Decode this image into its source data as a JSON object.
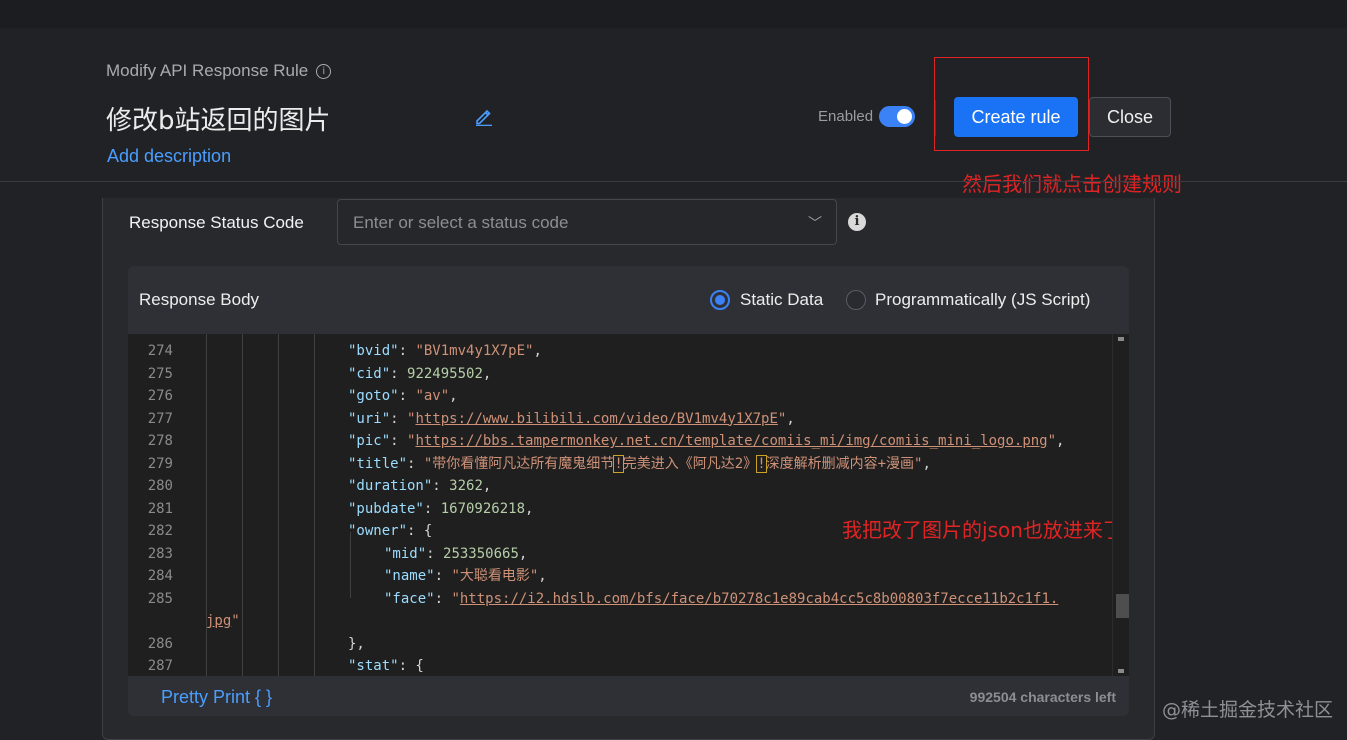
{
  "header": {
    "rule_type": "Modify API Response Rule",
    "info_glyph": "i",
    "rule_name": "修改b站返回的图片",
    "add_description": "Add description",
    "enabled_label": "Enabled",
    "enabled": true,
    "create_button": "Create rule",
    "close_button": "Close"
  },
  "annotations": {
    "create_note": "然后我们就点击创建规则",
    "json_note": "我把改了图片的json也放进来了"
  },
  "status": {
    "label": "Response Status Code",
    "placeholder": "Enter or select a status code",
    "chevron": "﹀",
    "info_glyph": "i"
  },
  "response_body": {
    "title": "Response Body",
    "options": [
      "Static Data",
      "Programmatically (JS Script)"
    ],
    "selected": "Static Data",
    "pretty_print": "Pretty Print { }",
    "chars_left": "992504 characters left"
  },
  "editor": {
    "lines": [
      {
        "n": "274",
        "indent": 4,
        "parts": [
          [
            "key",
            "\"bvid\""
          ],
          [
            "pun",
            ": "
          ],
          [
            "str",
            "\"BV1mv4y1X7pE\""
          ],
          [
            "pun",
            ","
          ]
        ]
      },
      {
        "n": "275",
        "indent": 4,
        "parts": [
          [
            "key",
            "\"cid\""
          ],
          [
            "pun",
            ": "
          ],
          [
            "num",
            "922495502"
          ],
          [
            "pun",
            ","
          ]
        ]
      },
      {
        "n": "276",
        "indent": 4,
        "parts": [
          [
            "key",
            "\"goto\""
          ],
          [
            "pun",
            ": "
          ],
          [
            "str",
            "\"av\""
          ],
          [
            "pun",
            ","
          ]
        ]
      },
      {
        "n": "277",
        "indent": 4,
        "parts": [
          [
            "key",
            "\"uri\""
          ],
          [
            "pun",
            ": "
          ],
          [
            "str",
            "\""
          ],
          [
            "url",
            "https://www.bilibili.com/video/BV1mv4y1X7pE"
          ],
          [
            "str",
            "\""
          ],
          [
            "pun",
            ","
          ]
        ]
      },
      {
        "n": "278",
        "indent": 4,
        "parts": [
          [
            "key",
            "\"pic\""
          ],
          [
            "pun",
            ": "
          ],
          [
            "str",
            "\""
          ],
          [
            "url",
            "https://bbs.tampermonkey.net.cn/template/comiis_mi/img/comiis_mini_logo.png"
          ],
          [
            "str",
            "\""
          ],
          [
            "pun",
            ","
          ]
        ]
      },
      {
        "n": "279",
        "indent": 4,
        "parts": [
          [
            "key",
            "\"title\""
          ],
          [
            "pun",
            ": "
          ],
          [
            "str",
            "\"带你看懂阿凡达所有魔鬼细节"
          ],
          [
            "hl",
            "!"
          ],
          [
            "str",
            "完美进入《阿凡达2》"
          ],
          [
            "hl",
            "!"
          ],
          [
            "str",
            "深度解析删减内容+漫画\""
          ],
          [
            "pun",
            ","
          ]
        ]
      },
      {
        "n": "280",
        "indent": 4,
        "parts": [
          [
            "key",
            "\"duration\""
          ],
          [
            "pun",
            ": "
          ],
          [
            "num",
            "3262"
          ],
          [
            "pun",
            ","
          ]
        ]
      },
      {
        "n": "281",
        "indent": 4,
        "parts": [
          [
            "key",
            "\"pubdate\""
          ],
          [
            "pun",
            ": "
          ],
          [
            "num",
            "1670926218"
          ],
          [
            "pun",
            ","
          ]
        ]
      },
      {
        "n": "282",
        "indent": 4,
        "parts": [
          [
            "key",
            "\"owner\""
          ],
          [
            "pun",
            ": {"
          ]
        ]
      },
      {
        "n": "283",
        "indent": 5,
        "parts": [
          [
            "key",
            "\"mid\""
          ],
          [
            "pun",
            ": "
          ],
          [
            "num",
            "253350665"
          ],
          [
            "pun",
            ","
          ]
        ]
      },
      {
        "n": "284",
        "indent": 5,
        "parts": [
          [
            "key",
            "\"name\""
          ],
          [
            "pun",
            ": "
          ],
          [
            "str",
            "\"大聪看电影\""
          ],
          [
            "pun",
            ","
          ]
        ]
      },
      {
        "n": "285",
        "indent": 5,
        "parts": [
          [
            "key",
            "\"face\""
          ],
          [
            "pun",
            ": "
          ],
          [
            "str",
            "\""
          ],
          [
            "url",
            "https://i2.hdslb.com/bfs/face/b70278c1e89cab4cc5c8b00803f7ecce11b2c1f1."
          ]
        ]
      },
      {
        "n": "",
        "indent": 0,
        "wrap": true,
        "parts": [
          [
            "url",
            "jpg"
          ],
          [
            "str",
            "\""
          ]
        ]
      },
      {
        "n": "286",
        "indent": 4,
        "parts": [
          [
            "pun",
            "},"
          ]
        ]
      },
      {
        "n": "287",
        "indent": 4,
        "parts": [
          [
            "key",
            "\"stat\""
          ],
          [
            "pun",
            ": {"
          ]
        ]
      }
    ]
  },
  "watermark": "@稀土掘金技术社区"
}
